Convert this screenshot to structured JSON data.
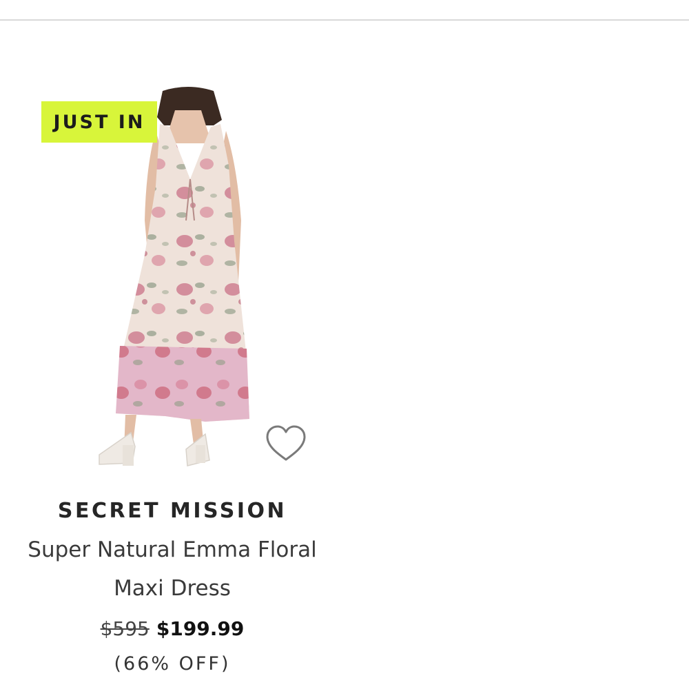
{
  "product": {
    "badge": "JUST IN",
    "image_alt": "Super Natural Emma Floral Maxi Dress",
    "brand": "SECRET MISSION",
    "name": "Super Natural Emma Floral Maxi Dress",
    "original_price": "$595",
    "sale_price": "$199.99",
    "discount": "(66% OFF)",
    "favorite_icon": "heart-outline-icon"
  },
  "colors": {
    "badge_bg": "#d8f53a",
    "dress_base": "#efe2da",
    "dress_hem": "#e3b7c9",
    "flower": "#c97186",
    "leaf": "#8f9c86"
  }
}
